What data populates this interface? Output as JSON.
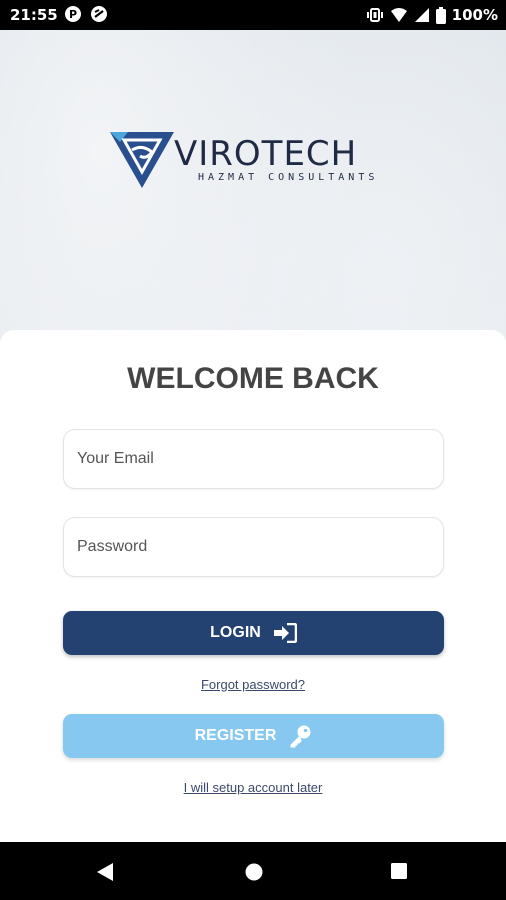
{
  "status_bar": {
    "time": "21:55",
    "battery": "100%",
    "icons": [
      "p-icon",
      "no-disturb-icon",
      "vibrate-icon",
      "wifi-icon",
      "signal-icon",
      "battery-icon"
    ]
  },
  "logo": {
    "name": "VIROTECH",
    "tagline": "HAZMAT CONSULTANTS"
  },
  "login_card": {
    "title": "WELCOME BACK",
    "email_placeholder": "Your Email",
    "password_placeholder": "Password",
    "login_label": "LOGIN",
    "forgot_label": "Forgot password?",
    "register_label": "REGISTER",
    "later_label": "I will setup account later"
  },
  "colors": {
    "login_button": "#234272",
    "register_button": "#86c8f0",
    "title_text": "#444444"
  },
  "nav_bar": {
    "icons": [
      "back-icon",
      "home-icon",
      "recents-icon"
    ]
  }
}
